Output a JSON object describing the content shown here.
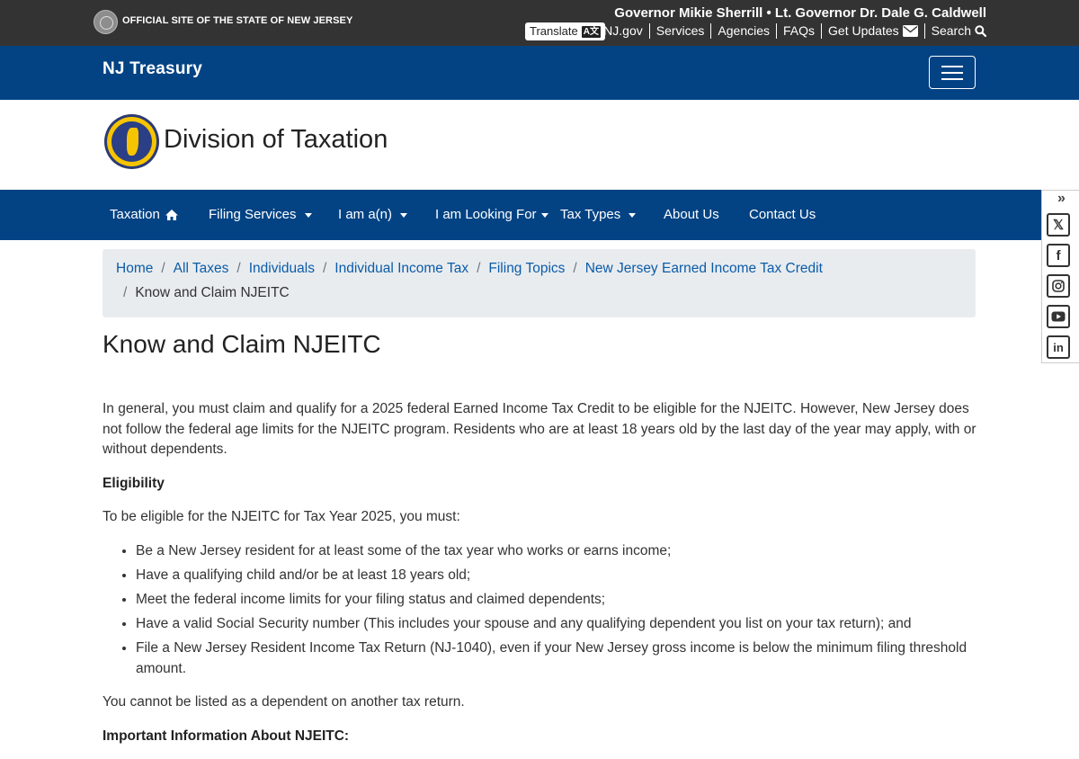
{
  "topbar": {
    "official": "OFFICIAL SITE OF THE STATE OF NEW JERSEY",
    "governor": "Governor Mikie Sherrill • Lt. Governor Dr. Dale G. Caldwell",
    "translate": "Translate",
    "links": [
      "NJ.gov",
      "Services",
      "Agencies",
      "FAQs",
      "Get Updates",
      "Search"
    ]
  },
  "treasury": {
    "title": "NJ Treasury"
  },
  "brand": {
    "title": "Division of Taxation"
  },
  "nav": {
    "items": [
      "Taxation",
      "Filing Services",
      "I am a(n)",
      "I am Looking For",
      "Tax Types",
      "About Us",
      "Contact Us"
    ]
  },
  "breadcrumb": {
    "items": [
      "Home",
      "All Taxes",
      "Individuals",
      "Individual Income Tax",
      "Filing Topics",
      "New Jersey Earned Income Tax Credit"
    ],
    "current": "Know and Claim NJEITC",
    "separator": "/"
  },
  "page": {
    "title": "Know and Claim NJEITC",
    "intro": "In general, you must claim and qualify for a 2025 federal Earned Income Tax Credit to be eligible for the NJEITC. However, New Jersey does not follow the federal age limits for the NJEITC program. Residents who are at least 18 years old by the last day of the year may apply, with or without dependents.",
    "eligibility_heading": "Eligibility",
    "eligibility_lead": "To be eligible for the NJEITC for Tax Year 2025, you must:",
    "requirements": [
      "Be a New Jersey resident for at least some of the tax year who works or earns income;",
      "Have a qualifying child and/or be at least 18 years old;",
      "Meet the federal income limits for your filing status and claimed dependents;",
      "Have a valid Social Security number (This includes your spouse and any qualifying dependent you list on your tax return); and",
      "File a New Jersey Resident Income Tax Return (NJ-1040), even if your New Jersey gross income is below the minimum filing threshold amount."
    ],
    "dependent_note": "You cannot be listed as a dependent on another tax return.",
    "important_heading": "Important Information About NJEITC:"
  },
  "icons": {
    "home": "home-icon",
    "envelope": "envelope-icon",
    "search": "search-icon",
    "translate": "translate-icon",
    "menu": "hamburger-menu-icon",
    "social": [
      "x-twitter-icon",
      "facebook-icon",
      "instagram-icon",
      "youtube-icon",
      "linkedin-icon"
    ]
  },
  "colors": {
    "topbar": "#333333",
    "brand_blue": "#034384",
    "link": "#0b5ca8",
    "breadcrumb_bg": "#e9ecef"
  }
}
